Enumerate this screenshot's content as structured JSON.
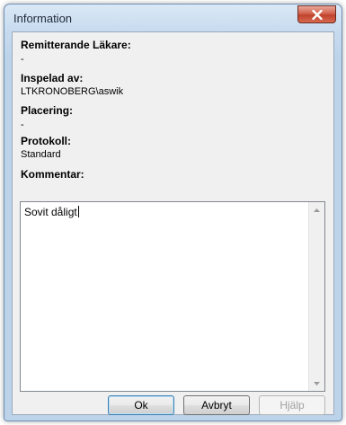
{
  "window": {
    "title": "Information"
  },
  "fields": [
    {
      "label": "Remitterande Läkare:",
      "value": "-"
    },
    {
      "label": "Inspelad av:",
      "value": "LTKRONOBERG\\aswik"
    },
    {
      "label": "Placering:",
      "value": "-"
    },
    {
      "label": "Protokoll:",
      "value": "Standard"
    }
  ],
  "comment": {
    "label": "Kommentar:",
    "value": "Sovit dåligt"
  },
  "buttons": {
    "ok": "Ok",
    "cancel": "Avbryt",
    "help": "Hjälp"
  }
}
